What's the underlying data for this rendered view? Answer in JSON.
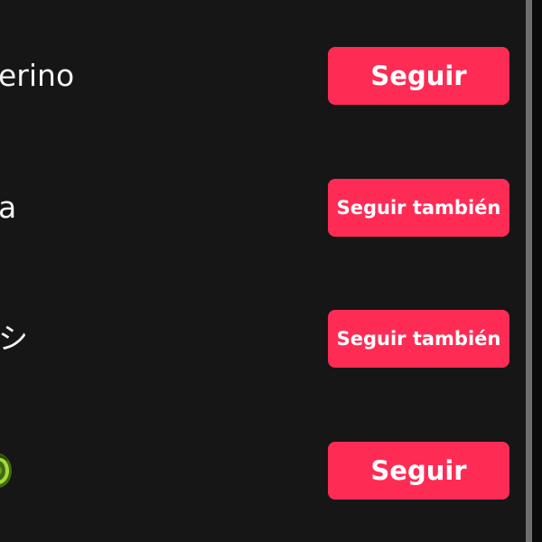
{
  "accent_color": "#fe2c55",
  "rows": [
    {
      "name": "erino",
      "button_label": "Seguir"
    },
    {
      "name": "a",
      "button_label": "Seguir también"
    },
    {
      "name": "シ",
      "button_label": "Seguir también"
    },
    {
      "name": "",
      "name_icon": "green-swirl-emoji-icon",
      "button_label": "Seguir"
    }
  ]
}
